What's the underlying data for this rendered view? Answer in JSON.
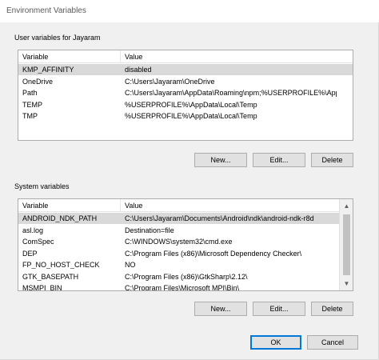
{
  "window": {
    "title": "Environment Variables"
  },
  "user_group": {
    "label": "User variables for Jayaram",
    "columns": [
      "Variable",
      "Value"
    ],
    "rows": [
      {
        "variable": "KMP_AFFINITY",
        "value": "disabled",
        "selected": true
      },
      {
        "variable": "OneDrive",
        "value": "C:\\Users\\Jayaram\\OneDrive"
      },
      {
        "variable": "Path",
        "value": "C:\\Users\\Jayaram\\AppData\\Roaming\\npm;%USERPROFILE%\\AppD..."
      },
      {
        "variable": "TEMP",
        "value": "%USERPROFILE%\\AppData\\Local\\Temp"
      },
      {
        "variable": "TMP",
        "value": "%USERPROFILE%\\AppData\\Local\\Temp"
      }
    ],
    "buttons": {
      "new": "New...",
      "edit": "Edit...",
      "delete": "Delete"
    }
  },
  "system_group": {
    "label": "System variables",
    "columns": [
      "Variable",
      "Value"
    ],
    "rows": [
      {
        "variable": "ANDROID_NDK_PATH",
        "value": "C:\\Users\\Jayaram\\Documents\\Android\\ndk\\android-ndk-r8d",
        "selected": true
      },
      {
        "variable": "asl.log",
        "value": "Destination=file"
      },
      {
        "variable": "ComSpec",
        "value": "C:\\WINDOWS\\system32\\cmd.exe"
      },
      {
        "variable": "DEP",
        "value": "C:\\Program Files (x86)\\Microsoft Dependency Checker\\"
      },
      {
        "variable": "FP_NO_HOST_CHECK",
        "value": "NO"
      },
      {
        "variable": "GTK_BASEPATH",
        "value": "C:\\Program Files (x86)\\GtkSharp\\2.12\\"
      },
      {
        "variable": "MSMPI_BIN",
        "value": "C:\\Program Files\\Microsoft MPI\\Bin\\"
      }
    ],
    "buttons": {
      "new": "New...",
      "edit": "Edit...",
      "delete": "Delete"
    }
  },
  "dialog_buttons": {
    "ok": "OK",
    "cancel": "Cancel"
  },
  "colors": {
    "selection": "#d9d9d9",
    "default_button_border": "#0078d7",
    "window_bg": "#f0f0f0"
  },
  "icons": {
    "scroll_up": "▲",
    "scroll_down": "▼"
  }
}
